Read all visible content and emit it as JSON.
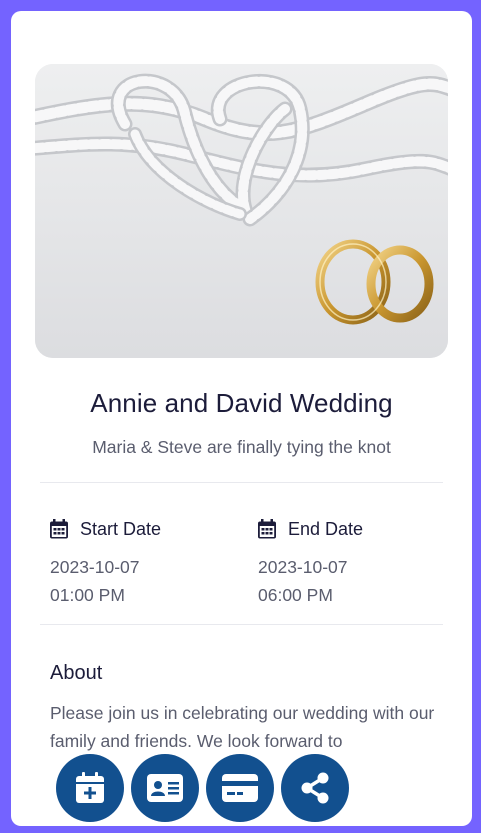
{
  "event": {
    "title": "Annie and David Wedding",
    "subtitle": "Maria & Steve are finally tying the knot",
    "hero_image": "wedding rope hearts and gold rings"
  },
  "dates": {
    "start": {
      "label": "Start Date",
      "date": "2023-10-07",
      "time": "01:00 PM",
      "icon": "calendar-icon"
    },
    "end": {
      "label": "End Date",
      "date": "2023-10-07",
      "time": "06:00 PM",
      "icon": "calendar-icon"
    }
  },
  "about": {
    "title": "About",
    "text": "Please join us in celebrating our wedding with our family and friends. We look forward to"
  },
  "actions": [
    {
      "name": "add-to-calendar",
      "icon": "calendar-plus-icon"
    },
    {
      "name": "contact-card",
      "icon": "id-card-icon"
    },
    {
      "name": "payment",
      "icon": "credit-card-icon"
    },
    {
      "name": "share",
      "icon": "share-icon"
    }
  ],
  "colors": {
    "page_background": "#7463ff",
    "card_background": "#ffffff",
    "action_button": "#12508f",
    "heading_text": "#1c1c3a",
    "body_text": "#5a5d6e"
  }
}
